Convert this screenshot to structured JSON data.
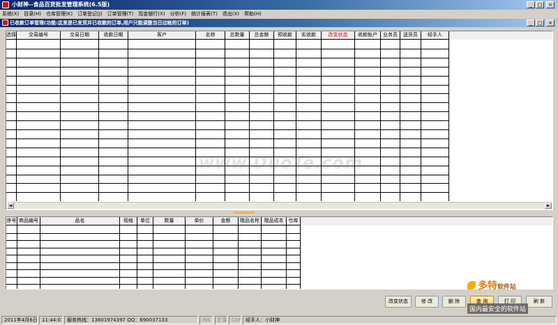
{
  "window": {
    "title": "小财神--食品百货批发管理系统(6.5版)",
    "min_label": "_",
    "max_label": "□",
    "close_label": "×"
  },
  "menu": [
    {
      "label": "系统(X)"
    },
    {
      "label": "目录(H)"
    },
    {
      "label": "仓库管理(K)"
    },
    {
      "label": "订单登记(J)"
    },
    {
      "label": "订单管理(T)"
    },
    {
      "label": "现金银行(X)"
    },
    {
      "label": "分析(F)"
    },
    {
      "label": "统计报表(T)"
    },
    {
      "label": "退出(X)"
    },
    {
      "label": "帮助(H)"
    }
  ],
  "subwindow": {
    "title": "已收款订单管理(功能:这里是已发货并已收款的订单,用户只能调整当日过帐的订单)",
    "min_label": "_",
    "max_label": "□",
    "close_label": "×"
  },
  "orders_table": {
    "columns": [
      "选择",
      "交易编号",
      "交易日期",
      "收款日期",
      "客户",
      "名称",
      "总数量",
      "总金额",
      "预收款",
      "实收款",
      "改变状态",
      "收款帐户",
      "业务员",
      "送货员",
      "经手人"
    ],
    "highlight_column": "改变状态",
    "highlight_color": "#e00000",
    "rows": []
  },
  "items_table": {
    "columns": [
      "序号",
      "商品编号",
      "品名",
      "规格",
      "单位",
      "数量",
      "单价",
      "金额",
      "赠品名称",
      "赠品成本",
      "仓库"
    ],
    "rows": []
  },
  "buttons": {
    "change_status": "改变状态",
    "edit": "修 改",
    "delete": "删 除",
    "query": "查 询",
    "print": "打 印",
    "refresh": "刷 新"
  },
  "scrollbar": {
    "left": "◄",
    "right": "►"
  },
  "status": {
    "date": "2011年4月6日",
    "time": "11:44:01",
    "hotline": "服务热线：13801974397 QQ：690037133",
    "num": "INS",
    "ext": "扩展",
    "caps": "CAPS",
    "handler": "经手人：小财神"
  },
  "watermarks": {
    "center": "www.DuoTe.com",
    "brand": "多特",
    "brand_sub": "软件站",
    "tagline": "国内最安全的软件站"
  },
  "colors": {
    "title_start": "#0a246a",
    "title_end": "#a6caf0",
    "face": "#d4d0c8",
    "query_button": "#ffc760"
  }
}
